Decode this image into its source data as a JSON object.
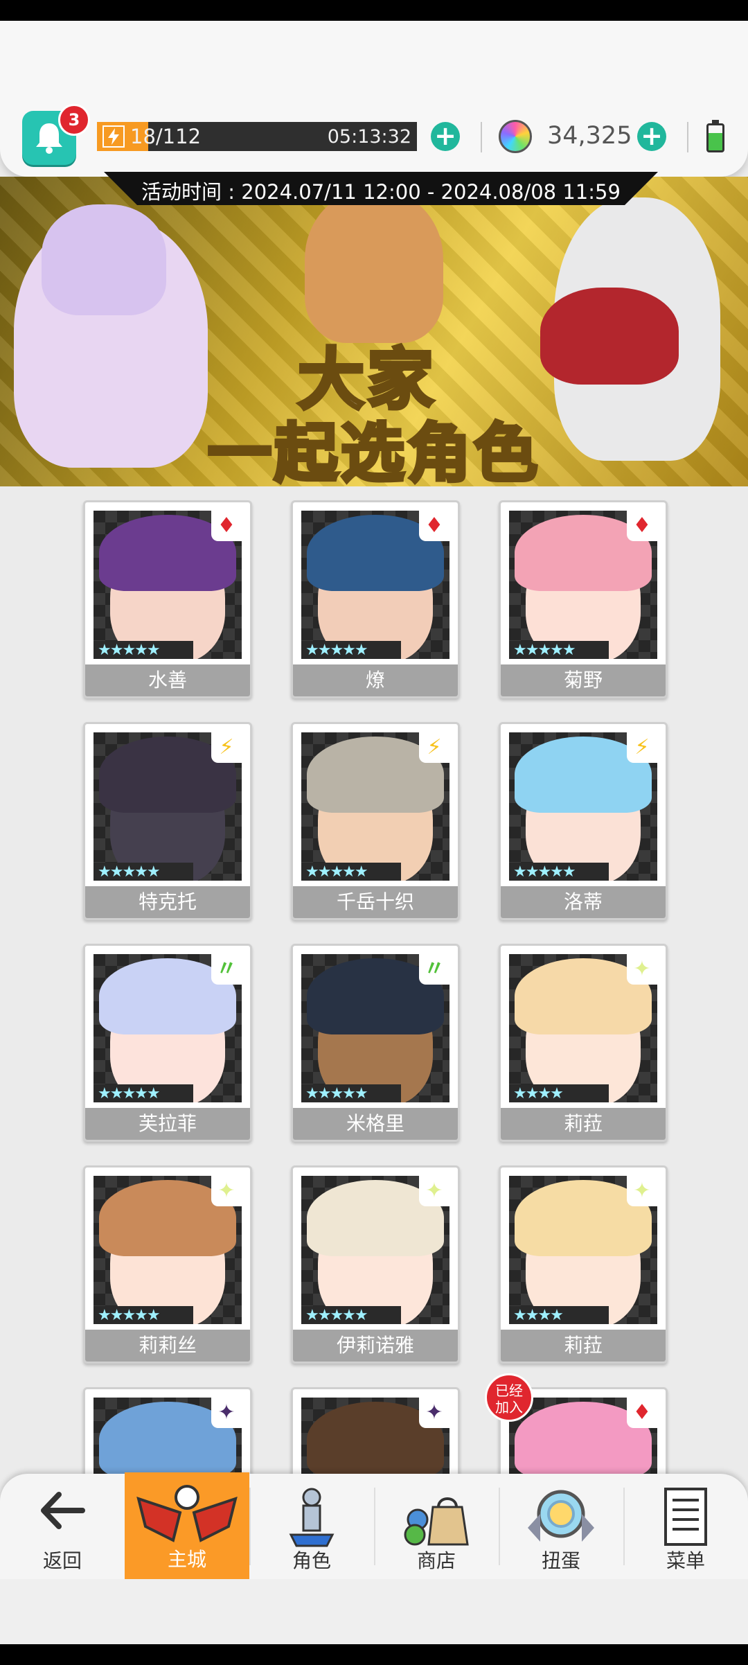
{
  "header": {
    "notification_count": "3",
    "stamina": "18/112",
    "stamina_fraction": 0.16,
    "stamina_timer": "05:13:32",
    "gems": "34,325"
  },
  "event": {
    "time_text": "活动时间 : 2024.07/11 12:00 - 2024.08/08 11:59",
    "title_line1": "大家",
    "title_line2": "一起选角色"
  },
  "characters": [
    {
      "name": "水善",
      "element": "fire",
      "elem_symbol": "♦",
      "elem_color": "#e0262e",
      "hair": "#6b3c8f",
      "face": "#f6d5c8",
      "stars": "★★★★★"
    },
    {
      "name": "燎",
      "element": "fire",
      "elem_symbol": "♦",
      "elem_color": "#e0262e",
      "hair": "#2f5b8c",
      "face": "#f2cdb8",
      "stars": "★★★★★"
    },
    {
      "name": "菊野",
      "element": "fire",
      "elem_symbol": "♦",
      "elem_color": "#e0262e",
      "hair": "#f3a3b5",
      "face": "#fde0d6",
      "stars": "★★★★★"
    },
    {
      "name": "特克托",
      "element": "thunder",
      "elem_symbol": "⚡",
      "elem_color": "#f7c21c",
      "hair": "#3a3344",
      "face": "#45404f",
      "stars": "★★★★★"
    },
    {
      "name": "千岳十织",
      "element": "thunder",
      "elem_symbol": "⚡",
      "elem_color": "#f7c21c",
      "hair": "#b9b3a6",
      "face": "#f2cfb3",
      "stars": "★★★★★"
    },
    {
      "name": "洛蒂",
      "element": "thunder",
      "elem_symbol": "⚡",
      "elem_color": "#f7c21c",
      "hair": "#8fd3f2",
      "face": "#fbe1d6",
      "stars": "★★★★★"
    },
    {
      "name": "芙拉菲",
      "element": "wind",
      "elem_symbol": "〃",
      "elem_color": "#52c13a",
      "hair": "#c9d2f5",
      "face": "#fde3dc",
      "stars": "★★★★★"
    },
    {
      "name": "米格里",
      "element": "wind",
      "elem_symbol": "〃",
      "elem_color": "#52c13a",
      "hair": "#283244",
      "face": "#a5774e",
      "stars": "★★★★★"
    },
    {
      "name": "莉菈",
      "element": "light",
      "elem_symbol": "✦",
      "elem_color": "#dff08f",
      "hair": "#f6d9a8",
      "face": "#fde6d8",
      "stars": "★★★★"
    },
    {
      "name": "莉莉丝",
      "element": "light",
      "elem_symbol": "✦",
      "elem_color": "#dff08f",
      "hair": "#c98a5a",
      "face": "#fde3d6",
      "stars": "★★★★★"
    },
    {
      "name": "伊莉诺雅",
      "element": "light",
      "elem_symbol": "✦",
      "elem_color": "#dff08f",
      "hair": "#efe6d3",
      "face": "#fde6da",
      "stars": "★★★★★"
    },
    {
      "name": "莉菈",
      "element": "light",
      "elem_symbol": "✦",
      "elem_color": "#dff08f",
      "hair": "#f6dca4",
      "face": "#fde6d8",
      "stars": "★★★★"
    },
    {
      "name": "",
      "element": "dark",
      "elem_symbol": "✦",
      "elem_color": "#4a2d6b",
      "hair": "#6fa2d8",
      "face": "#fde0d6",
      "stars": ""
    },
    {
      "name": "",
      "element": "dark",
      "elem_symbol": "✦",
      "elem_color": "#4a2d6b",
      "hair": "#5a3e2a",
      "face": "#f1cbb3",
      "stars": ""
    },
    {
      "name": "",
      "element": "fire",
      "elem_symbol": "♦",
      "elem_color": "#e0262e",
      "hair": "#f39ac2",
      "face": "#fde0d6",
      "stars": "",
      "badge": "已经\n加入"
    }
  ],
  "nav": {
    "back": "返回",
    "home": "主城",
    "characters": "角色",
    "shop": "商店",
    "gacha": "扭蛋",
    "menu": "菜单"
  },
  "colors": {
    "accent_orange": "#fb9a27",
    "teal": "#27c4b2",
    "badge_red": "#e0262e"
  }
}
